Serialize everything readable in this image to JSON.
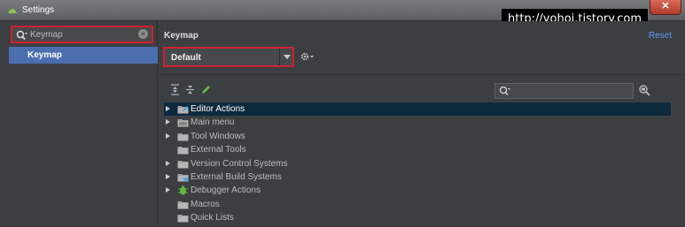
{
  "window": {
    "title": "Settings",
    "close_label": "✕"
  },
  "watermark": "http://yohoi.tistory.com",
  "sidebar": {
    "search": {
      "value": "Keymap"
    },
    "items": [
      {
        "label": "Keymap"
      }
    ]
  },
  "main": {
    "title": "Keymap",
    "reset_label": "Reset",
    "keymap_select": {
      "value": "Default"
    },
    "filter": {
      "value": ""
    },
    "tree": [
      {
        "label": "Editor Actions",
        "expandable": true,
        "selected": true,
        "icon": "editor-actions-icon"
      },
      {
        "label": "Main menu",
        "expandable": true,
        "selected": false,
        "icon": "main-menu-icon"
      },
      {
        "label": "Tool Windows",
        "expandable": true,
        "selected": false,
        "icon": "folder-icon"
      },
      {
        "label": "External Tools",
        "expandable": false,
        "selected": false,
        "icon": "folder-icon"
      },
      {
        "label": "Version Control Systems",
        "expandable": true,
        "selected": false,
        "icon": "folder-icon"
      },
      {
        "label": "External Build Systems",
        "expandable": true,
        "selected": false,
        "icon": "external-build-icon"
      },
      {
        "label": "Debugger Actions",
        "expandable": true,
        "selected": false,
        "icon": "debugger-icon"
      },
      {
        "label": "Macros",
        "expandable": false,
        "selected": false,
        "icon": "folder-icon"
      },
      {
        "label": "Quick Lists",
        "expandable": false,
        "selected": false,
        "icon": "folder-icon"
      }
    ]
  },
  "colors": {
    "selection": "#4b6eaf",
    "tree_selection": "#0d293e",
    "link": "#589df6",
    "highlight_border": "#d02030"
  }
}
